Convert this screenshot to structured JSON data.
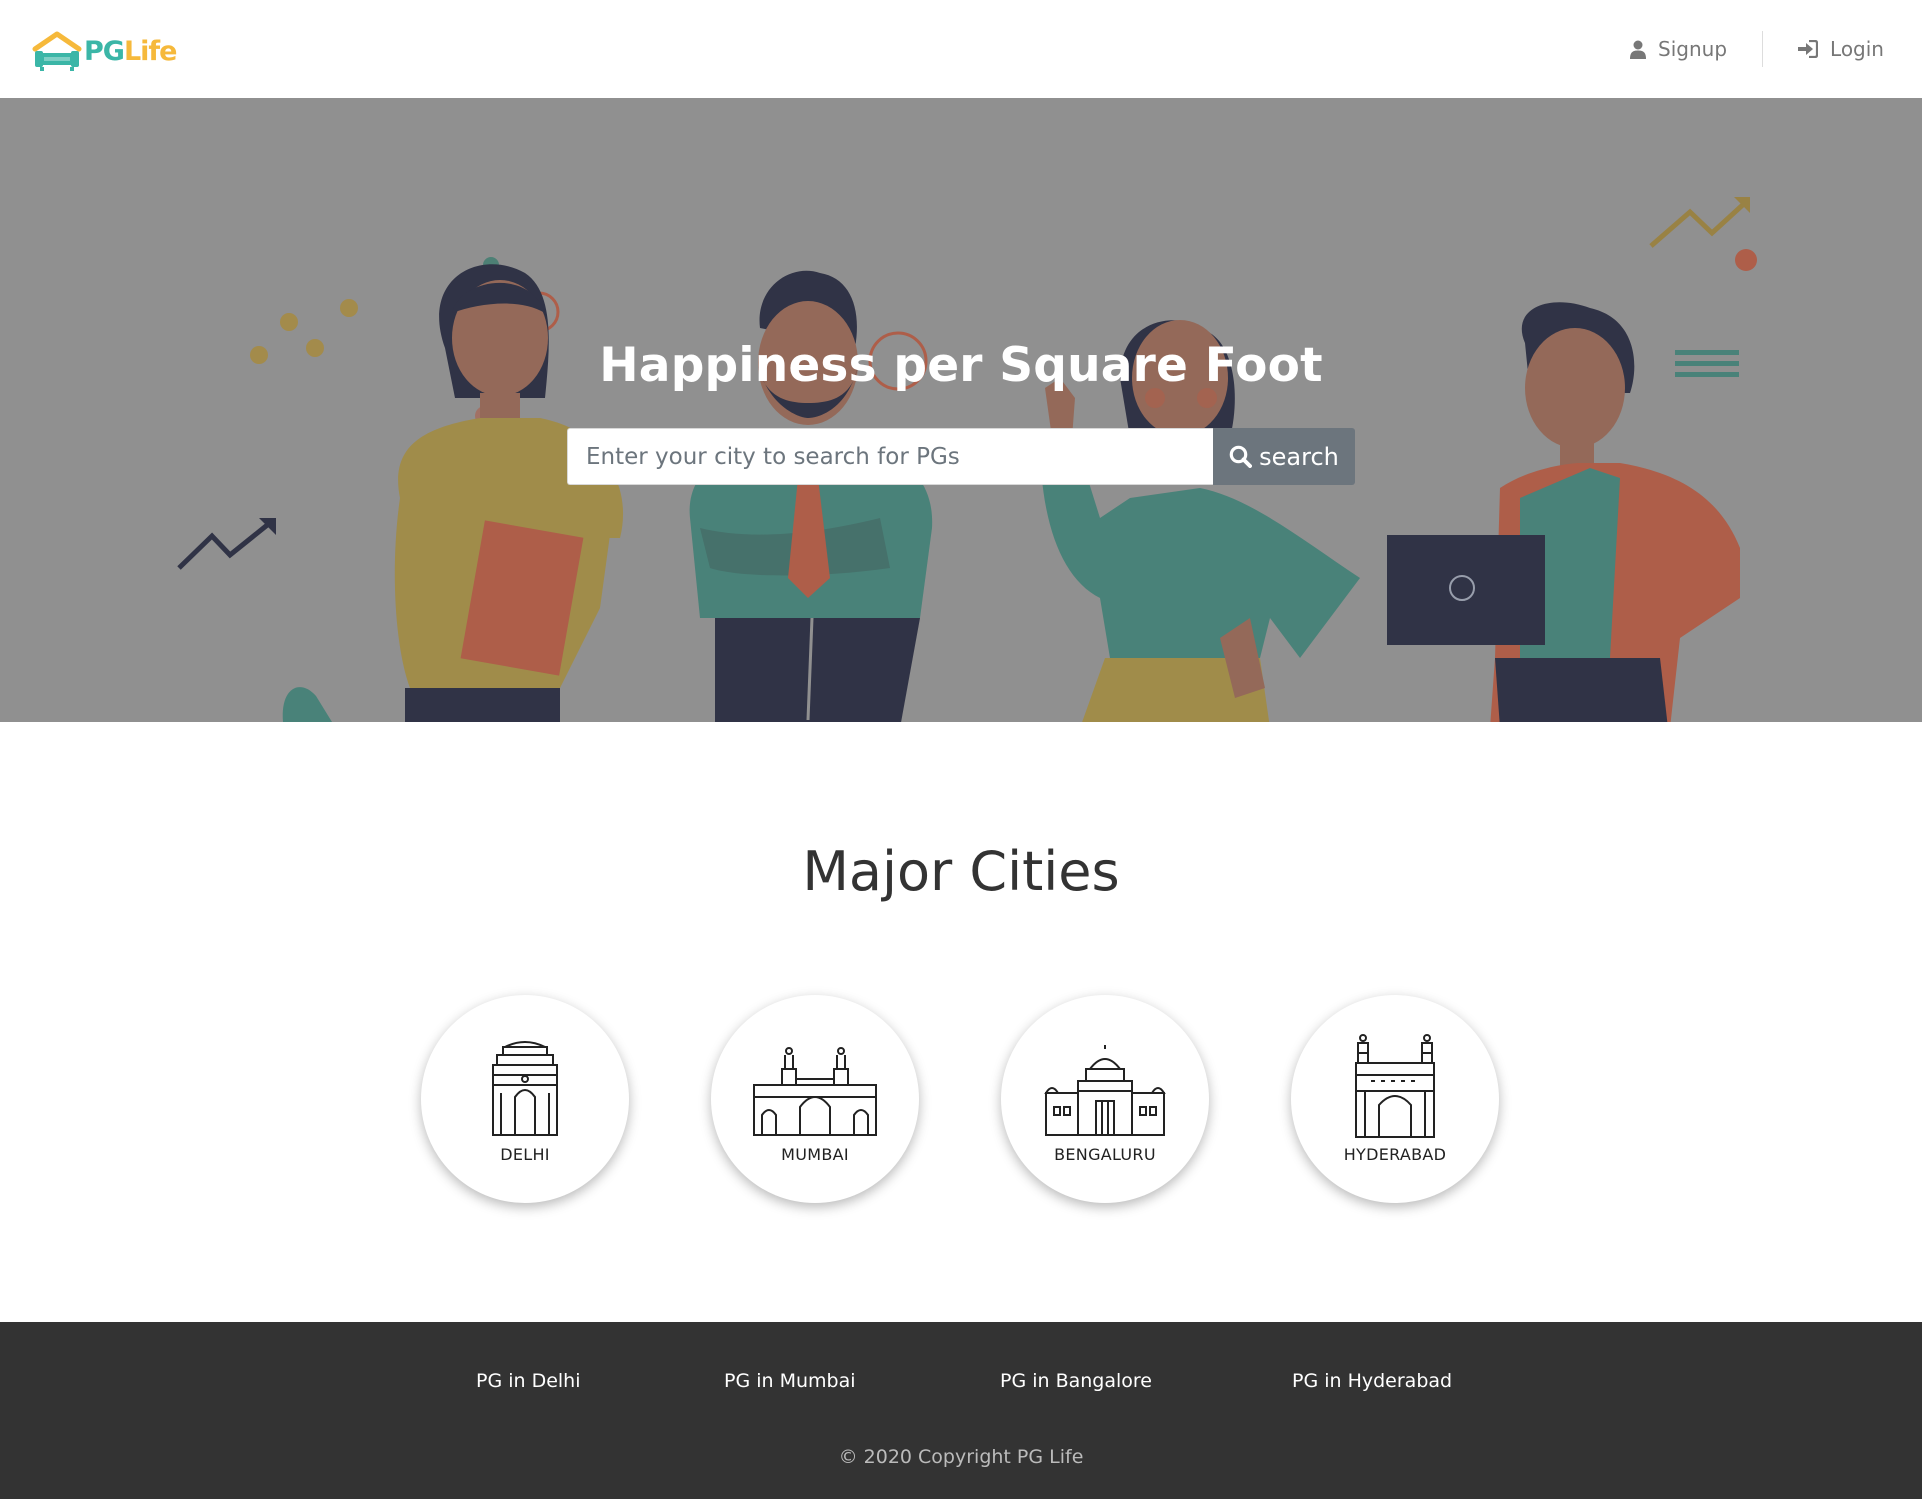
{
  "header": {
    "logo_pg": "PG",
    "logo_life": "Life",
    "signup_label": "Signup",
    "login_label": "Login"
  },
  "hero": {
    "title": "Happiness per Square Foot",
    "search_placeholder": "Enter your city to search for PGs",
    "search_value": "",
    "search_button": "search"
  },
  "cities": {
    "title": "Major Cities",
    "items": [
      {
        "name": "DELHI",
        "icon": "india-gate-icon"
      },
      {
        "name": "MUMBAI",
        "icon": "gateway-of-india-icon"
      },
      {
        "name": "BENGALURU",
        "icon": "vidhana-soudha-icon"
      },
      {
        "name": "HYDERABAD",
        "icon": "charminar-icon"
      }
    ]
  },
  "footer": {
    "links": [
      "PG in Delhi",
      "PG in Mumbai",
      "PG in Bangalore",
      "PG in Hyderabad"
    ],
    "copyright": "© 2020 Copyright PG Life"
  },
  "colors": {
    "brand_teal": "#3bb6a7",
    "brand_yellow": "#f6b93b",
    "hero_overlay": "#909090",
    "search_button": "#6c757d",
    "footer_bg": "#333333"
  }
}
